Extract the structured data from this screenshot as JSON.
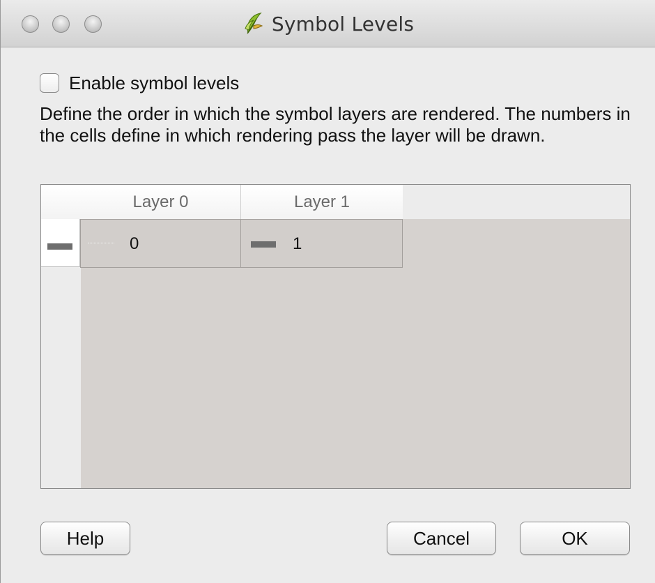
{
  "window": {
    "title": "Symbol Levels",
    "app_icon": "qgis-icon"
  },
  "options": {
    "enable_label": "Enable symbol levels",
    "enable_checked": false
  },
  "description": "Define the order in which the symbol layers are rendered. The numbers in the cells define in which rendering pass the layer will be drawn.",
  "table": {
    "columns": [
      "Layer 0",
      "Layer 1"
    ],
    "rows": [
      {
        "icon": "line-symbol-icon",
        "cells": [
          "0",
          "1"
        ]
      }
    ]
  },
  "buttons": {
    "help": "Help",
    "cancel": "Cancel",
    "ok": "OK"
  },
  "colors": {
    "window_bg": "#ececec",
    "table_bg": "#d6d2cf",
    "cell_bg": "#d2cecb",
    "symbol_swatch": "#6e6e6e"
  }
}
